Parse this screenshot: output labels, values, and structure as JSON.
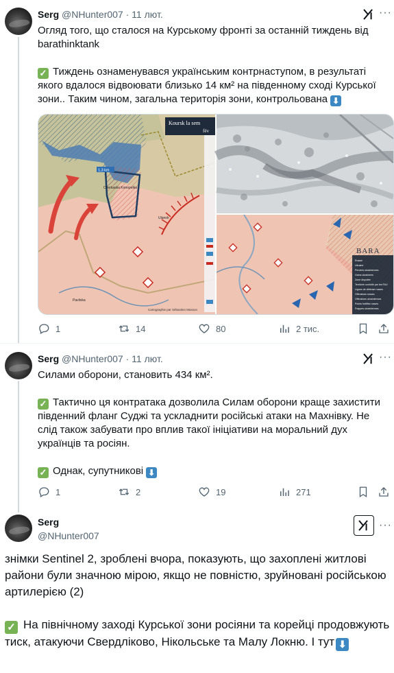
{
  "tweet1": {
    "name": "Serg",
    "handle": "@NHunter007",
    "dot": "·",
    "time": "11 лют.",
    "line1": "Огляд того, що сталося на Курському фронті за останній тиждень від",
    "line2": "barathinktank",
    "body": "Тиждень ознаменувався українським контрнаступом, в результаті якого вдалося відвоювати близько 14 км² на південному сході Курської зони.. Таким чином, загальна територія зони, контрольована",
    "media": {
      "map_title": "Koursk la sem",
      "map_subtitle": "fév",
      "map_credit": "Cartographie par Sébastien Masson",
      "map_labels": [
        "Cherkaska Konopelka",
        "Ulanok",
        "Pavlivka"
      ],
      "distance_badge": "1,3 km",
      "bara_logo": "BARA",
      "legend_items": [
        "Russie",
        "Ukraine",
        "Percées ukrainiennes",
        "Gains ukrainiens",
        "Zone disputée",
        "Territoire contrôlé par les FAU",
        "Lignes de défense russes",
        "Offensives russes",
        "Offensives ukrainiennes",
        "Points fortifiés russes",
        "Frappes ukrainiennes"
      ]
    },
    "replies": "1",
    "reposts": "14",
    "likes": "80",
    "views": "2 тис."
  },
  "tweet2": {
    "name": "Serg",
    "handle": "@NHunter007",
    "dot": "·",
    "time": "11 лют.",
    "line1": "Силами оборони, становить 434 км².",
    "body": "Тактично ця контратака дозволила Силам оборони краще захистити південний фланг Суджі та ускладнити російські атаки на Махнівку. Не слід також забувати про вплив такої ініціативи на моральний дух українців та росіян.",
    "line3": "Однак, супутникові",
    "replies": "1",
    "reposts": "2",
    "likes": "19",
    "views": "271"
  },
  "tweet3": {
    "name": "Serg",
    "handle": "@NHunter007",
    "para1": "знімки Sentinel 2, зроблені вчора, показують, що захоплені житлові райони були значною мірою, якщо не повністю, зруйновані російською артилерією (2)",
    "para2": "На північному заході Курської зони росіяни та корейці продовжують тиск, атакуючи Свердліково, Нікольське та Малу Локню. І тут"
  },
  "icons": {
    "check": "white-heavy-check-mark-icon",
    "down": "down-arrow-button-icon",
    "grok": "grok-icon",
    "more": "more-dots-icon",
    "reply": "reply-icon",
    "repost": "repost-icon",
    "like": "heart-icon",
    "views": "views-chart-icon",
    "bookmark": "bookmark-icon",
    "share": "share-icon"
  },
  "colors": {
    "text": "#0f1419",
    "secondary": "#536471",
    "check_green": "#77b255",
    "arrow_blue": "#3b88c3",
    "ru_zone": "#f2c4b8",
    "ua_zone": "#5b86b5"
  }
}
